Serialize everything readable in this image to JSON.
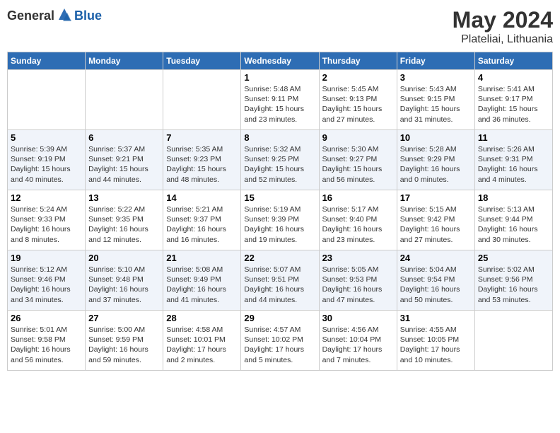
{
  "header": {
    "logo_general": "General",
    "logo_blue": "Blue",
    "month": "May 2024",
    "location": "Plateliai, Lithuania"
  },
  "weekdays": [
    "Sunday",
    "Monday",
    "Tuesday",
    "Wednesday",
    "Thursday",
    "Friday",
    "Saturday"
  ],
  "weeks": [
    [
      {
        "day": "",
        "info": ""
      },
      {
        "day": "",
        "info": ""
      },
      {
        "day": "",
        "info": ""
      },
      {
        "day": "1",
        "info": "Sunrise: 5:48 AM\nSunset: 9:11 PM\nDaylight: 15 hours\nand 23 minutes."
      },
      {
        "day": "2",
        "info": "Sunrise: 5:45 AM\nSunset: 9:13 PM\nDaylight: 15 hours\nand 27 minutes."
      },
      {
        "day": "3",
        "info": "Sunrise: 5:43 AM\nSunset: 9:15 PM\nDaylight: 15 hours\nand 31 minutes."
      },
      {
        "day": "4",
        "info": "Sunrise: 5:41 AM\nSunset: 9:17 PM\nDaylight: 15 hours\nand 36 minutes."
      }
    ],
    [
      {
        "day": "5",
        "info": "Sunrise: 5:39 AM\nSunset: 9:19 PM\nDaylight: 15 hours\nand 40 minutes."
      },
      {
        "day": "6",
        "info": "Sunrise: 5:37 AM\nSunset: 9:21 PM\nDaylight: 15 hours\nand 44 minutes."
      },
      {
        "day": "7",
        "info": "Sunrise: 5:35 AM\nSunset: 9:23 PM\nDaylight: 15 hours\nand 48 minutes."
      },
      {
        "day": "8",
        "info": "Sunrise: 5:32 AM\nSunset: 9:25 PM\nDaylight: 15 hours\nand 52 minutes."
      },
      {
        "day": "9",
        "info": "Sunrise: 5:30 AM\nSunset: 9:27 PM\nDaylight: 15 hours\nand 56 minutes."
      },
      {
        "day": "10",
        "info": "Sunrise: 5:28 AM\nSunset: 9:29 PM\nDaylight: 16 hours\nand 0 minutes."
      },
      {
        "day": "11",
        "info": "Sunrise: 5:26 AM\nSunset: 9:31 PM\nDaylight: 16 hours\nand 4 minutes."
      }
    ],
    [
      {
        "day": "12",
        "info": "Sunrise: 5:24 AM\nSunset: 9:33 PM\nDaylight: 16 hours\nand 8 minutes."
      },
      {
        "day": "13",
        "info": "Sunrise: 5:22 AM\nSunset: 9:35 PM\nDaylight: 16 hours\nand 12 minutes."
      },
      {
        "day": "14",
        "info": "Sunrise: 5:21 AM\nSunset: 9:37 PM\nDaylight: 16 hours\nand 16 minutes."
      },
      {
        "day": "15",
        "info": "Sunrise: 5:19 AM\nSunset: 9:39 PM\nDaylight: 16 hours\nand 19 minutes."
      },
      {
        "day": "16",
        "info": "Sunrise: 5:17 AM\nSunset: 9:40 PM\nDaylight: 16 hours\nand 23 minutes."
      },
      {
        "day": "17",
        "info": "Sunrise: 5:15 AM\nSunset: 9:42 PM\nDaylight: 16 hours\nand 27 minutes."
      },
      {
        "day": "18",
        "info": "Sunrise: 5:13 AM\nSunset: 9:44 PM\nDaylight: 16 hours\nand 30 minutes."
      }
    ],
    [
      {
        "day": "19",
        "info": "Sunrise: 5:12 AM\nSunset: 9:46 PM\nDaylight: 16 hours\nand 34 minutes."
      },
      {
        "day": "20",
        "info": "Sunrise: 5:10 AM\nSunset: 9:48 PM\nDaylight: 16 hours\nand 37 minutes."
      },
      {
        "day": "21",
        "info": "Sunrise: 5:08 AM\nSunset: 9:49 PM\nDaylight: 16 hours\nand 41 minutes."
      },
      {
        "day": "22",
        "info": "Sunrise: 5:07 AM\nSunset: 9:51 PM\nDaylight: 16 hours\nand 44 minutes."
      },
      {
        "day": "23",
        "info": "Sunrise: 5:05 AM\nSunset: 9:53 PM\nDaylight: 16 hours\nand 47 minutes."
      },
      {
        "day": "24",
        "info": "Sunrise: 5:04 AM\nSunset: 9:54 PM\nDaylight: 16 hours\nand 50 minutes."
      },
      {
        "day": "25",
        "info": "Sunrise: 5:02 AM\nSunset: 9:56 PM\nDaylight: 16 hours\nand 53 minutes."
      }
    ],
    [
      {
        "day": "26",
        "info": "Sunrise: 5:01 AM\nSunset: 9:58 PM\nDaylight: 16 hours\nand 56 minutes."
      },
      {
        "day": "27",
        "info": "Sunrise: 5:00 AM\nSunset: 9:59 PM\nDaylight: 16 hours\nand 59 minutes."
      },
      {
        "day": "28",
        "info": "Sunrise: 4:58 AM\nSunset: 10:01 PM\nDaylight: 17 hours\nand 2 minutes."
      },
      {
        "day": "29",
        "info": "Sunrise: 4:57 AM\nSunset: 10:02 PM\nDaylight: 17 hours\nand 5 minutes."
      },
      {
        "day": "30",
        "info": "Sunrise: 4:56 AM\nSunset: 10:04 PM\nDaylight: 17 hours\nand 7 minutes."
      },
      {
        "day": "31",
        "info": "Sunrise: 4:55 AM\nSunset: 10:05 PM\nDaylight: 17 hours\nand 10 minutes."
      },
      {
        "day": "",
        "info": ""
      }
    ]
  ]
}
